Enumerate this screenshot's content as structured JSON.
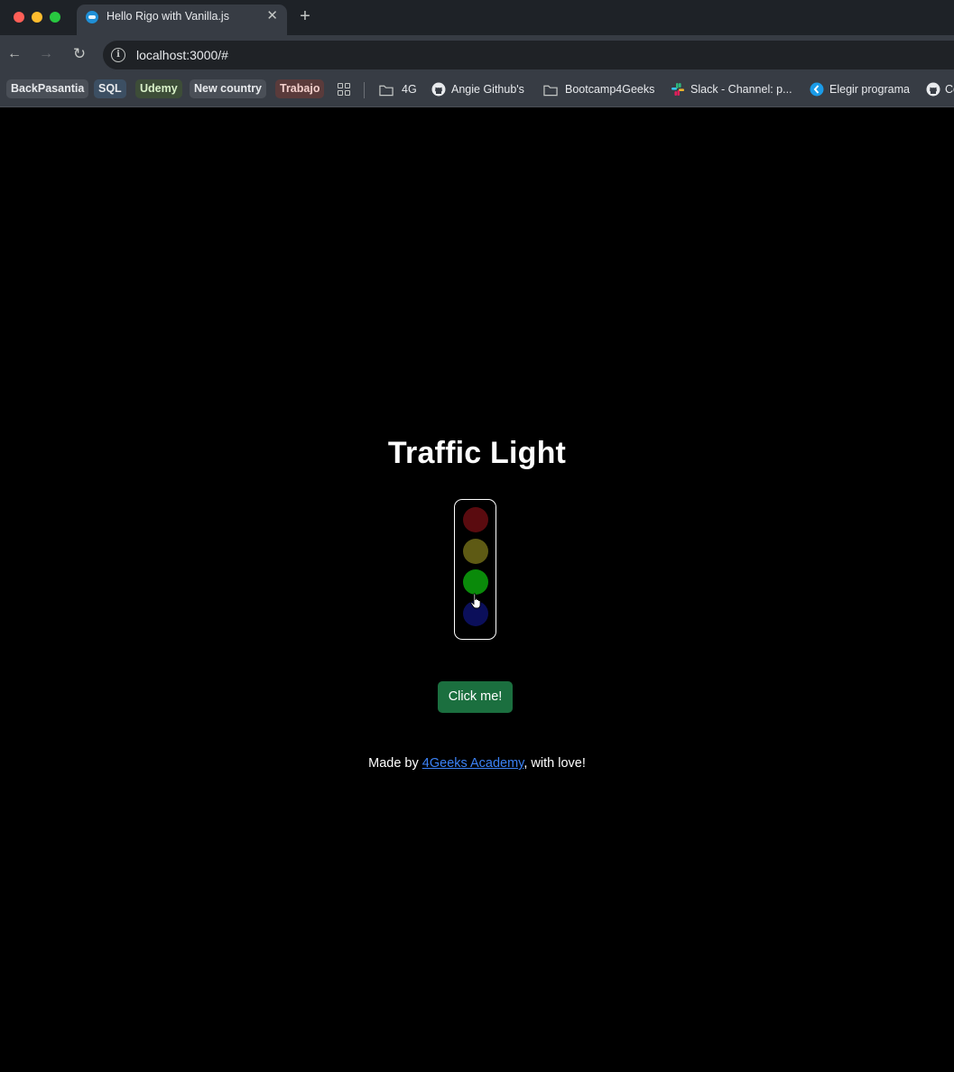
{
  "browser": {
    "tab": {
      "title": "Hello Rigo with Vanilla.js",
      "close_glyph": "✕"
    },
    "new_tab_glyph": "+",
    "nav": {
      "back_glyph": "←",
      "forward_glyph": "→",
      "reload_glyph": "↻"
    },
    "omnibox": {
      "url": "localhost:3000/#",
      "site_info_icon": "info-icon"
    },
    "bookmarks": [
      {
        "label": "BackPasantia",
        "style": "chip",
        "color": "#e8eaed",
        "bg": "#4a4f57"
      },
      {
        "label": "SQL",
        "style": "chip",
        "color": "#e8eaed",
        "bg": "#3c4f63"
      },
      {
        "label": "Udemy",
        "style": "chip",
        "color": "#d8f0c8",
        "bg": "#3d4d38"
      },
      {
        "label": "New country",
        "style": "chip",
        "color": "#e8eaed",
        "bg": "#4a4f57"
      },
      {
        "label": "Trabajo",
        "style": "chip",
        "color": "#f3d0cc",
        "bg": "#5a3b3b"
      },
      {
        "label": "4G",
        "style": "folder"
      },
      {
        "label": "Angie Github's",
        "style": "github"
      },
      {
        "label": "Bootcamp4Geeks",
        "style": "folder"
      },
      {
        "label": "Slack - Channel: p...",
        "style": "slack"
      },
      {
        "label": "Elegir programa",
        "style": "site"
      },
      {
        "label": "Co",
        "style": "github"
      }
    ]
  },
  "page": {
    "heading": "Traffic Light",
    "lights": [
      {
        "name": "red",
        "color": "#5a0b0f"
      },
      {
        "name": "yellow",
        "color": "#5e5a14"
      },
      {
        "name": "green",
        "color": "#0a8a0a"
      },
      {
        "name": "blue",
        "color": "#0b0f5a"
      }
    ],
    "button_label": "Click me!",
    "footer": {
      "prefix": "Made by ",
      "link_text": "4Geeks Academy",
      "suffix": ", with love!"
    }
  }
}
